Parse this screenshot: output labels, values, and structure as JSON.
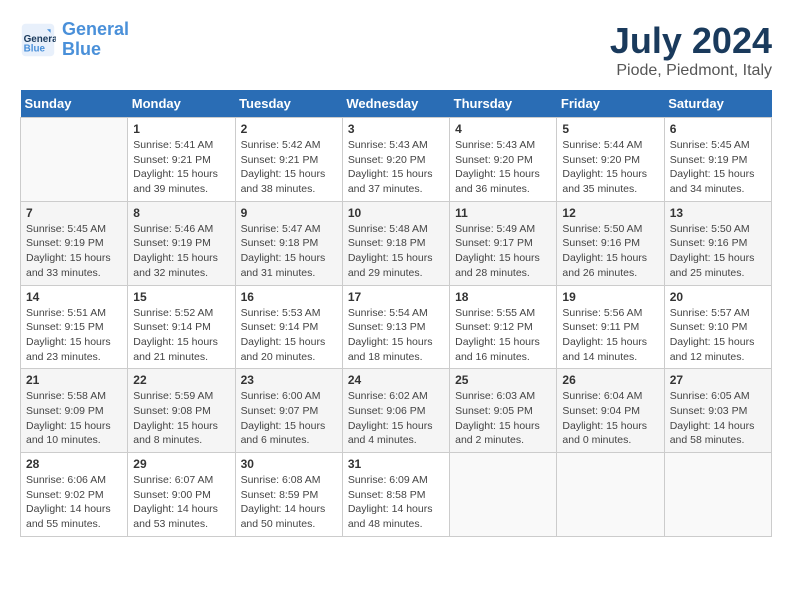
{
  "header": {
    "logo_line1": "General",
    "logo_line2": "Blue",
    "month_year": "July 2024",
    "location": "Piode, Piedmont, Italy"
  },
  "days_of_week": [
    "Sunday",
    "Monday",
    "Tuesday",
    "Wednesday",
    "Thursday",
    "Friday",
    "Saturday"
  ],
  "weeks": [
    [
      {
        "day": "",
        "info": ""
      },
      {
        "day": "1",
        "info": "Sunrise: 5:41 AM\nSunset: 9:21 PM\nDaylight: 15 hours\nand 39 minutes."
      },
      {
        "day": "2",
        "info": "Sunrise: 5:42 AM\nSunset: 9:21 PM\nDaylight: 15 hours\nand 38 minutes."
      },
      {
        "day": "3",
        "info": "Sunrise: 5:43 AM\nSunset: 9:20 PM\nDaylight: 15 hours\nand 37 minutes."
      },
      {
        "day": "4",
        "info": "Sunrise: 5:43 AM\nSunset: 9:20 PM\nDaylight: 15 hours\nand 36 minutes."
      },
      {
        "day": "5",
        "info": "Sunrise: 5:44 AM\nSunset: 9:20 PM\nDaylight: 15 hours\nand 35 minutes."
      },
      {
        "day": "6",
        "info": "Sunrise: 5:45 AM\nSunset: 9:19 PM\nDaylight: 15 hours\nand 34 minutes."
      }
    ],
    [
      {
        "day": "7",
        "info": "Sunrise: 5:45 AM\nSunset: 9:19 PM\nDaylight: 15 hours\nand 33 minutes."
      },
      {
        "day": "8",
        "info": "Sunrise: 5:46 AM\nSunset: 9:19 PM\nDaylight: 15 hours\nand 32 minutes."
      },
      {
        "day": "9",
        "info": "Sunrise: 5:47 AM\nSunset: 9:18 PM\nDaylight: 15 hours\nand 31 minutes."
      },
      {
        "day": "10",
        "info": "Sunrise: 5:48 AM\nSunset: 9:18 PM\nDaylight: 15 hours\nand 29 minutes."
      },
      {
        "day": "11",
        "info": "Sunrise: 5:49 AM\nSunset: 9:17 PM\nDaylight: 15 hours\nand 28 minutes."
      },
      {
        "day": "12",
        "info": "Sunrise: 5:50 AM\nSunset: 9:16 PM\nDaylight: 15 hours\nand 26 minutes."
      },
      {
        "day": "13",
        "info": "Sunrise: 5:50 AM\nSunset: 9:16 PM\nDaylight: 15 hours\nand 25 minutes."
      }
    ],
    [
      {
        "day": "14",
        "info": "Sunrise: 5:51 AM\nSunset: 9:15 PM\nDaylight: 15 hours\nand 23 minutes."
      },
      {
        "day": "15",
        "info": "Sunrise: 5:52 AM\nSunset: 9:14 PM\nDaylight: 15 hours\nand 21 minutes."
      },
      {
        "day": "16",
        "info": "Sunrise: 5:53 AM\nSunset: 9:14 PM\nDaylight: 15 hours\nand 20 minutes."
      },
      {
        "day": "17",
        "info": "Sunrise: 5:54 AM\nSunset: 9:13 PM\nDaylight: 15 hours\nand 18 minutes."
      },
      {
        "day": "18",
        "info": "Sunrise: 5:55 AM\nSunset: 9:12 PM\nDaylight: 15 hours\nand 16 minutes."
      },
      {
        "day": "19",
        "info": "Sunrise: 5:56 AM\nSunset: 9:11 PM\nDaylight: 15 hours\nand 14 minutes."
      },
      {
        "day": "20",
        "info": "Sunrise: 5:57 AM\nSunset: 9:10 PM\nDaylight: 15 hours\nand 12 minutes."
      }
    ],
    [
      {
        "day": "21",
        "info": "Sunrise: 5:58 AM\nSunset: 9:09 PM\nDaylight: 15 hours\nand 10 minutes."
      },
      {
        "day": "22",
        "info": "Sunrise: 5:59 AM\nSunset: 9:08 PM\nDaylight: 15 hours\nand 8 minutes."
      },
      {
        "day": "23",
        "info": "Sunrise: 6:00 AM\nSunset: 9:07 PM\nDaylight: 15 hours\nand 6 minutes."
      },
      {
        "day": "24",
        "info": "Sunrise: 6:02 AM\nSunset: 9:06 PM\nDaylight: 15 hours\nand 4 minutes."
      },
      {
        "day": "25",
        "info": "Sunrise: 6:03 AM\nSunset: 9:05 PM\nDaylight: 15 hours\nand 2 minutes."
      },
      {
        "day": "26",
        "info": "Sunrise: 6:04 AM\nSunset: 9:04 PM\nDaylight: 15 hours\nand 0 minutes."
      },
      {
        "day": "27",
        "info": "Sunrise: 6:05 AM\nSunset: 9:03 PM\nDaylight: 14 hours\nand 58 minutes."
      }
    ],
    [
      {
        "day": "28",
        "info": "Sunrise: 6:06 AM\nSunset: 9:02 PM\nDaylight: 14 hours\nand 55 minutes."
      },
      {
        "day": "29",
        "info": "Sunrise: 6:07 AM\nSunset: 9:00 PM\nDaylight: 14 hours\nand 53 minutes."
      },
      {
        "day": "30",
        "info": "Sunrise: 6:08 AM\nSunset: 8:59 PM\nDaylight: 14 hours\nand 50 minutes."
      },
      {
        "day": "31",
        "info": "Sunrise: 6:09 AM\nSunset: 8:58 PM\nDaylight: 14 hours\nand 48 minutes."
      },
      {
        "day": "",
        "info": ""
      },
      {
        "day": "",
        "info": ""
      },
      {
        "day": "",
        "info": ""
      }
    ]
  ]
}
